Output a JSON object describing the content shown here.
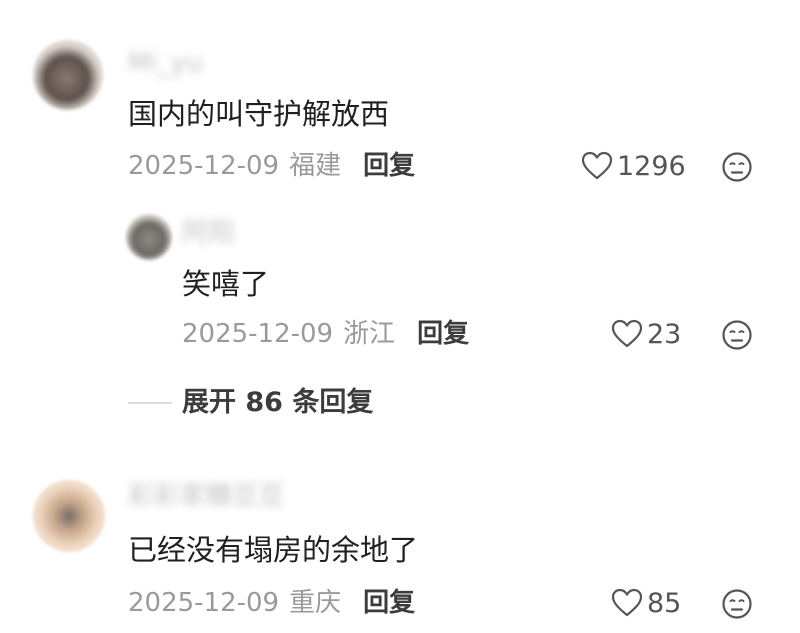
{
  "comments": [
    {
      "username": "Mi_yu",
      "text": "国内的叫守护解放西",
      "date": "2025-12-09",
      "location": "福建",
      "reply_label": "回复",
      "likes": "1296"
    },
    {
      "username": "阿阳",
      "text": "笑嘻了",
      "date": "2025-12-09",
      "location": "浙江",
      "reply_label": "回复",
      "likes": "23"
    },
    {
      "username": "彩彩家糖豆豆",
      "text": "已经没有塌房的余地了",
      "date": "2025-12-09",
      "location": "重庆",
      "reply_label": "回复",
      "likes": "85"
    }
  ],
  "expand_replies": {
    "label": "展开 86 条回复"
  },
  "icons": {
    "like": "heart-outline-icon",
    "dislike": "neutral-face-icon"
  },
  "colors": {
    "text": "#202020",
    "meta": "#9a9a9a",
    "reply": "#3c3c3c",
    "icon": "#555555"
  }
}
